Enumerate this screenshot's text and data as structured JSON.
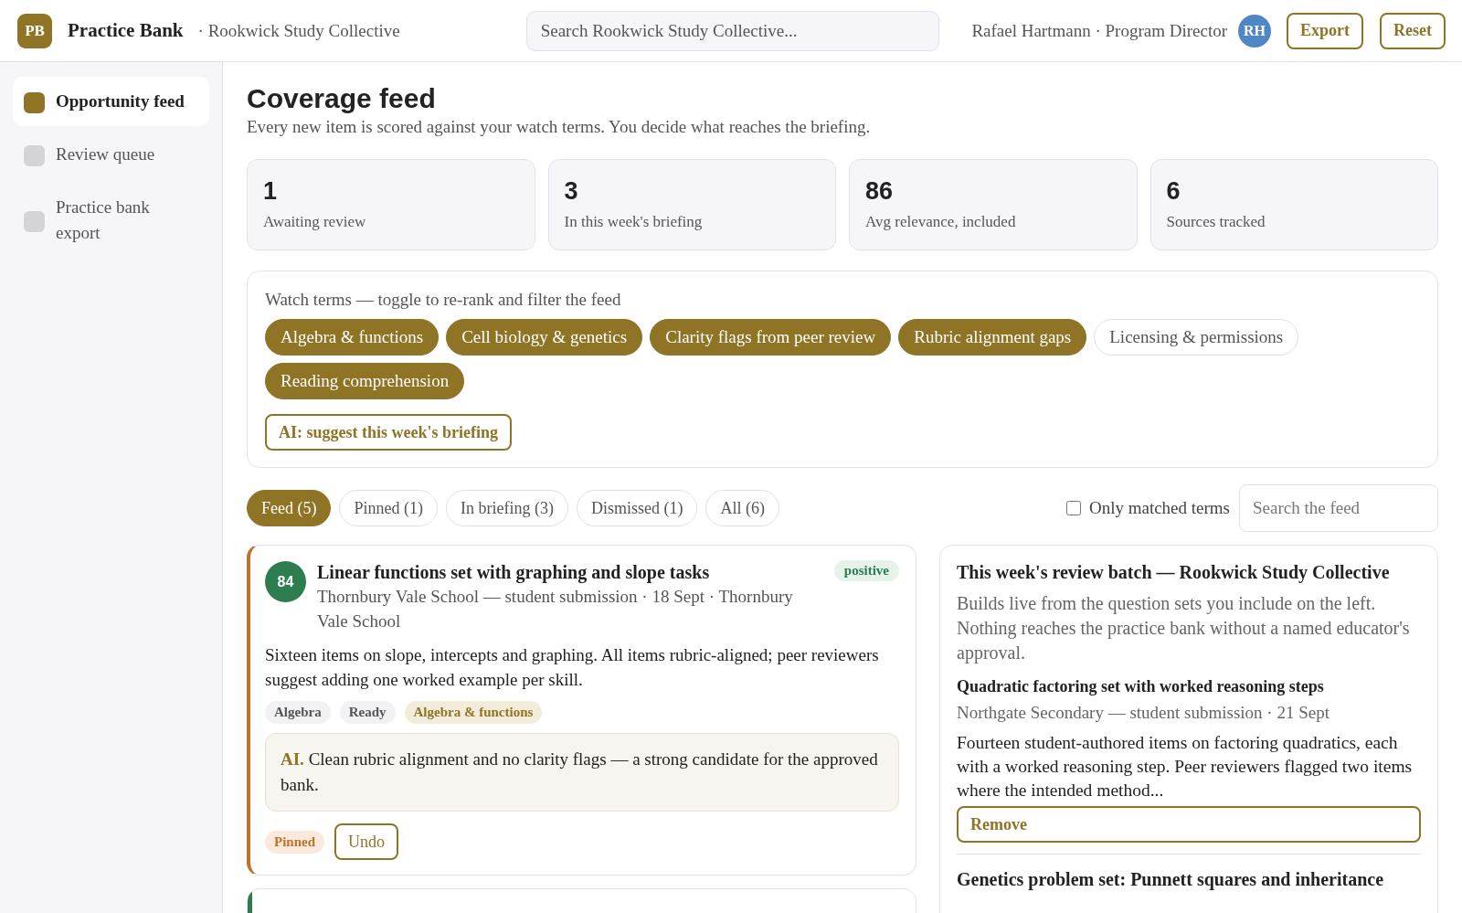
{
  "app": {
    "logo": "PB",
    "name": "Practice Bank",
    "org": "· Rookwick Study Collective"
  },
  "search": {
    "placeholder": "Search Rookwick Study Collective..."
  },
  "user": {
    "label": "Rafael Hartmann · Program Director",
    "initials": "RH"
  },
  "header_buttons": [
    "Export",
    "Reset"
  ],
  "sidebar": {
    "items": [
      {
        "label": "Opportunity feed",
        "selected": true
      },
      {
        "label": "Review queue",
        "selected": false
      },
      {
        "label": "Practice bank export",
        "selected": false
      }
    ]
  },
  "page": {
    "title": "Coverage feed",
    "subtitle": "Every new item is scored against your watch terms. You decide what reaches the briefing."
  },
  "stats": [
    {
      "value": "1",
      "label": "Awaiting review"
    },
    {
      "value": "3",
      "label": "In this week's briefing"
    },
    {
      "value": "86",
      "label": "Avg relevance, included"
    },
    {
      "value": "6",
      "label": "Sources tracked"
    }
  ],
  "watch_terms": {
    "label": "Watch terms — toggle to re-rank and filter the feed",
    "terms": [
      {
        "label": "Algebra & functions",
        "on": true
      },
      {
        "label": "Cell biology & genetics",
        "on": true
      },
      {
        "label": "Clarity flags from peer review",
        "on": true
      },
      {
        "label": "Rubric alignment gaps",
        "on": true
      },
      {
        "label": "Licensing & permissions",
        "on": false
      },
      {
        "label": "Reading comprehension",
        "on": true
      }
    ],
    "ai_button": "AI: suggest this week's briefing"
  },
  "filters": {
    "tabs": [
      {
        "label": "Feed (5)",
        "selected": true
      },
      {
        "label": "Pinned (1)",
        "selected": false
      },
      {
        "label": "In briefing (3)",
        "selected": false
      },
      {
        "label": "Dismissed (1)",
        "selected": false
      },
      {
        "label": "All (6)",
        "selected": false
      }
    ],
    "only_matched": {
      "label": "Only matched terms",
      "checked": false
    },
    "search": {
      "placeholder": "Search the feed"
    }
  },
  "feed": [
    {
      "kind": "full",
      "color": "#c0722a",
      "score": "84",
      "title": "Linear functions set with graphing and slope tasks",
      "meta": "Thornbury Vale School — student submission · 18 Sept · Thornbury Vale School",
      "sentiment": "positive",
      "summary": "Sixteen items on slope, intercepts and graphing. All items rubric-aligned; peer reviewers suggest adding one worked example per skill.",
      "tags": [
        {
          "label": "Algebra",
          "kind": "plain"
        },
        {
          "label": "Ready",
          "kind": "plain"
        },
        {
          "label": "Algebra & functions",
          "kind": "term"
        }
      ],
      "ai": "**AI.** Clean rubric alignment and no clarity flags — a strong candidate for the approved bank.",
      "status": "Pinned",
      "action": "Undo"
    },
    {
      "kind": "edge",
      "color": "#2e7d4f"
    }
  ],
  "briefing": {
    "title": "This week's review batch — Rookwick Study Collective",
    "description": "Builds live from the question sets you include on the left. Nothing reaches the practice bank without a named educator's approval.",
    "items": [
      {
        "title": "Quadratic factoring set with worked reasoning steps",
        "meta": "Northgate Secondary — student submission · 21 Sept",
        "summary": "Fourteen student-authored items on factoring quadratics, each with a worked reasoning step. Peer reviewers flagged two items where the intended method...",
        "action": "Remove"
      },
      {
        "title": "Genetics problem set: Punnett squares and inheritance"
      }
    ]
  }
}
